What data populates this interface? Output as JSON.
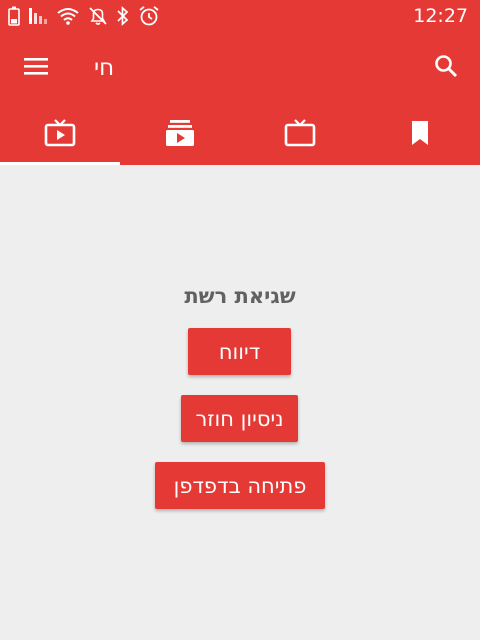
{
  "status_bar": {
    "time": "12:27",
    "icons": [
      "battery-icon",
      "signal-icon",
      "wifi-icon",
      "notifications-off-icon",
      "bluetooth-icon",
      "alarm-icon"
    ]
  },
  "toolbar": {
    "title": "חי",
    "menu_icon": "hamburger-menu-icon",
    "search_icon": "search-icon"
  },
  "tabs": [
    {
      "icon": "live-tv-icon",
      "active": true
    },
    {
      "icon": "subscriptions-icon",
      "active": false
    },
    {
      "icon": "tv-icon",
      "active": false
    },
    {
      "icon": "bookmark-icon",
      "active": false
    }
  ],
  "error": {
    "title": "שגיאת רשת",
    "report_label": "דיווח",
    "retry_label": "ניסיון חוזר",
    "open_browser_label": "פתיחה בדפדפן"
  },
  "colors": {
    "primary": "#E53935",
    "background": "#EEEEEE",
    "error_text": "#616161",
    "on_primary": "#FFFFFF"
  }
}
